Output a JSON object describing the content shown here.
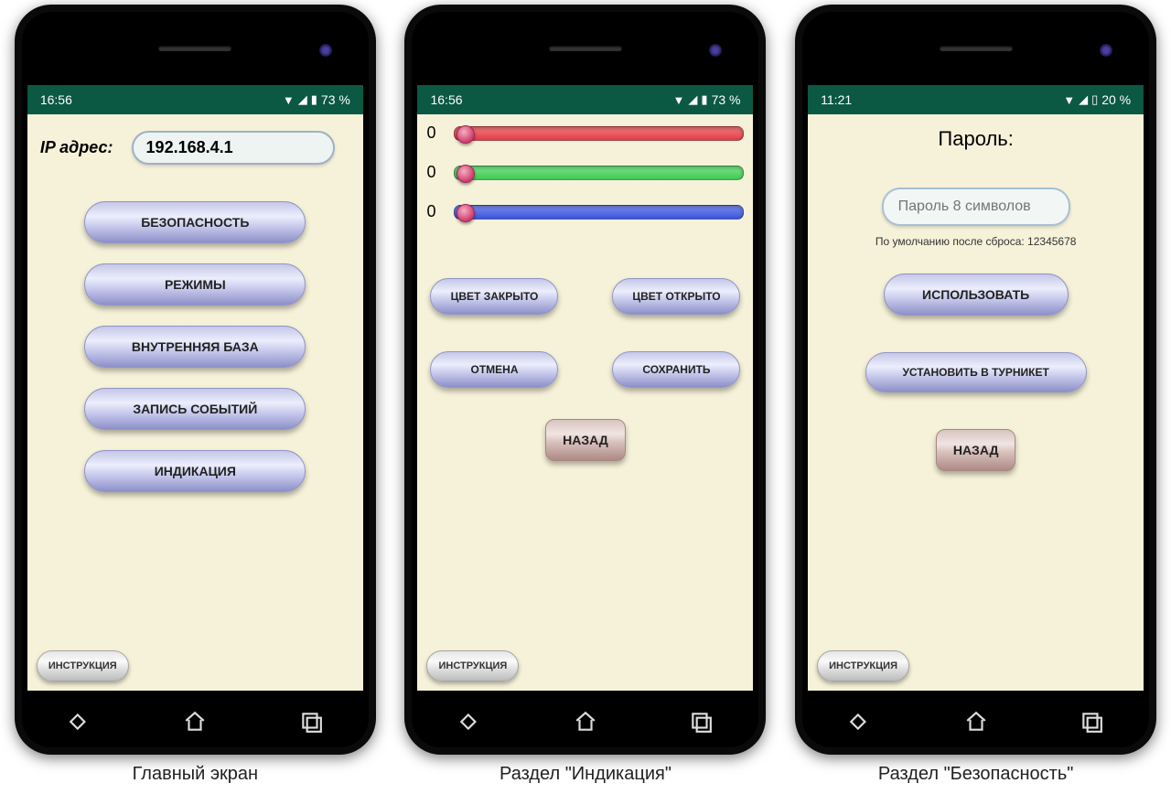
{
  "phone1": {
    "status": {
      "time": "16:56",
      "battery": "73 %"
    },
    "ip_label": "IP адрес:",
    "ip_value": "192.168.4.1",
    "menu": [
      "БЕЗОПАСНОСТЬ",
      "РЕЖИМЫ",
      "ВНУТРЕННЯЯ БАЗА",
      "ЗАПИСЬ СОБЫТИЙ",
      "ИНДИКАЦИЯ"
    ],
    "instruction": "ИНСТРУКЦИЯ",
    "caption": "Главный экран"
  },
  "phone2": {
    "status": {
      "time": "16:56",
      "battery": "73 %"
    },
    "sliders": {
      "r": 0,
      "g": 0,
      "b": 0
    },
    "btn_closed": "ЦВЕТ ЗАКРЫТО",
    "btn_open": "ЦВЕТ ОТКРЫТО",
    "btn_cancel": "ОТМЕНА",
    "btn_save": "СОХРАНИТЬ",
    "btn_back": "НАЗАД",
    "instruction": "ИНСТРУКЦИЯ",
    "caption": "Раздел \"Индикация\""
  },
  "phone3": {
    "status": {
      "time": "11:21",
      "battery": "20 %"
    },
    "pwd_title": "Пароль:",
    "pwd_placeholder": "Пароль 8 символов",
    "pwd_hint": "По умолчанию после сброса: 12345678",
    "btn_use": "ИСПОЛЬЗОВАТЬ",
    "btn_set": "УСТАНОВИТЬ В ТУРНИКЕТ",
    "btn_back": "НАЗАД",
    "instruction": "ИНСТРУКЦИЯ",
    "caption": "Раздел \"Безопасность\""
  }
}
